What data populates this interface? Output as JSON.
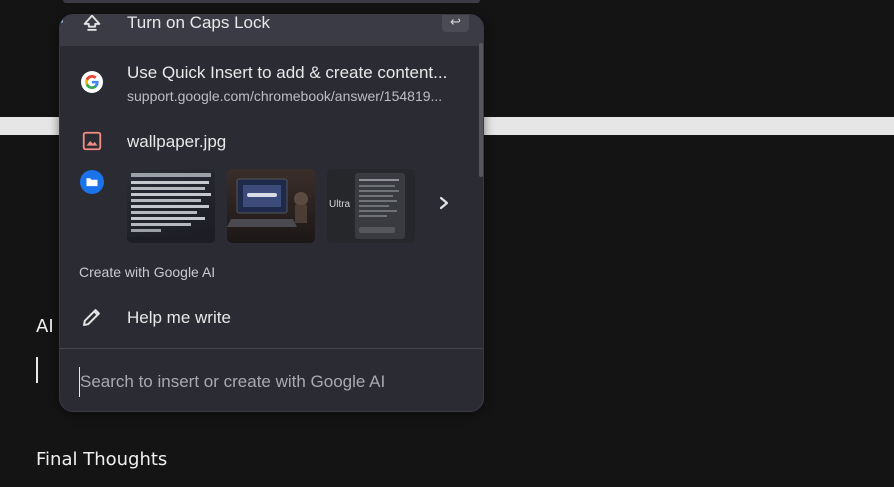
{
  "document": {
    "line_ai": "AI",
    "line_final": "Final Thoughts"
  },
  "picker": {
    "items": [
      {
        "title": "Turn on Caps Lock",
        "icon": "caps-lock-icon",
        "shortcut": "↩"
      },
      {
        "title": "Use Quick Insert to add & create content...",
        "subtitle": "support.google.com/chromebook/answer/154819...",
        "icon": "google-icon"
      },
      {
        "title": "wallpaper.jpg",
        "icon": "image-file-icon"
      }
    ],
    "files_icon": "folder-icon",
    "thumbnails": [
      {
        "name": "spreadsheet-thumbnail"
      },
      {
        "name": "laptop-photo-thumbnail"
      },
      {
        "name": "ultra-screenshot-thumbnail",
        "label": "Ultra"
      }
    ],
    "next_icon": "chevron-right-icon",
    "section_label": "Create with Google AI",
    "help": {
      "title": "Help me write",
      "icon": "pencil-icon"
    },
    "search": {
      "placeholder": "Search to insert or create with Google AI",
      "value": ""
    }
  },
  "colors": {
    "background": "#141414",
    "panel": "#2b2c33",
    "selected_row": "#3a3b45",
    "accent": "#a8c7fa",
    "folder_blue": "#1a73e8"
  }
}
